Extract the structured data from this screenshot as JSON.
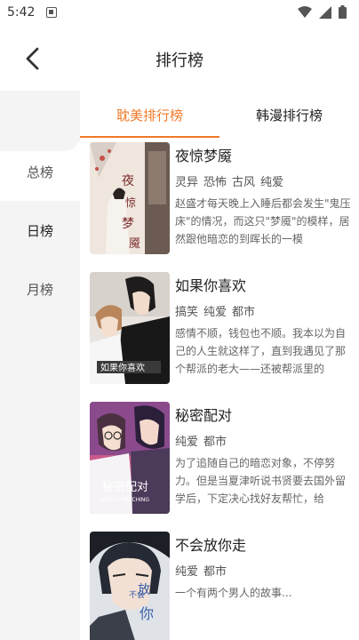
{
  "status": {
    "time": "5:42"
  },
  "header": {
    "title": "排行榜"
  },
  "sidebar": {
    "items": [
      {
        "label": "总榜"
      },
      {
        "label": "日榜"
      },
      {
        "label": "月榜"
      }
    ]
  },
  "tabs": [
    {
      "label": "耽美排行榜"
    },
    {
      "label": "韩漫排行榜"
    }
  ],
  "books": [
    {
      "title": "夜惊梦魇",
      "tags": [
        "灵异",
        "恐怖",
        "古风",
        "纯爱"
      ],
      "desc": "赵盛才每天晚上入睡后都会发生\"鬼压床\"的情况，而这只\"梦魇\"的模样，居然跟他暗恋的到晖长的一模"
    },
    {
      "title": "如果你喜欢",
      "tags": [
        "搞笑",
        "纯爱",
        "都市"
      ],
      "desc": "感情不顺，钱包也不顺。我本以为自己的人生就这样了，直到我遇见了那个帮派的老大——还被帮派里的"
    },
    {
      "title": "秘密配对",
      "tags": [
        "纯爱",
        "都市"
      ],
      "desc": "为了追随自己的暗恋对象，不停努力。但是当夏津听说书贤要去国外留学后，下定决心找好友帮忙，给"
    },
    {
      "title": "不会放你走",
      "tags": [
        "纯爱",
        "都市"
      ],
      "desc": "一个有两个男人的故事..."
    }
  ],
  "colors": {
    "accent": "#f07a2a",
    "sidebar_bg": "#f4f4f4"
  }
}
